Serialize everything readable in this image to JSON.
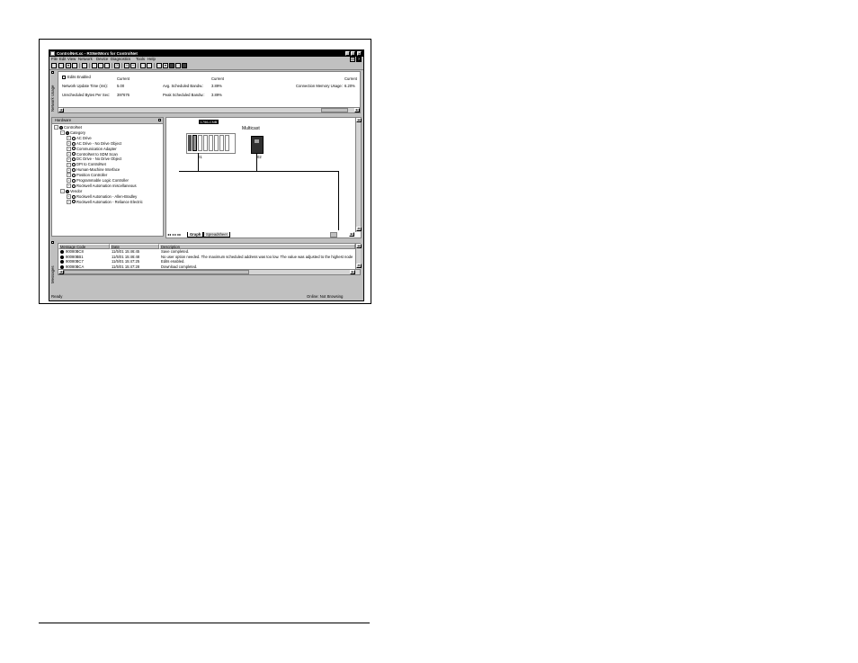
{
  "window": {
    "title": "ControlNet.xc - RSNetWorx for ControlNet"
  },
  "menu": [
    "File",
    "Edit",
    "View",
    "Network",
    "Device",
    "Diagnostics",
    "Tools",
    "Help"
  ],
  "network_usage": {
    "side_label": "Network Usage",
    "edits_enabled_label": "Edits Enabled",
    "col_current": "Current",
    "update_time_label": "Network Update Time (ms):",
    "update_time_value": "5.00",
    "unscheduled_label": "Unscheduled Bytes Per Sec:",
    "unscheduled_value": "397676",
    "avg_sched_label": "Avg. Scheduled Bandw.:",
    "avg_sched_value": "3.89%",
    "peak_sched_label": "Peak Scheduled Bandw.:",
    "peak_sched_value": "3.89%",
    "conn_mem_label": "Connection Memory Usage:",
    "conn_mem_value": "6.20%"
  },
  "hardware": {
    "title": "Hardware",
    "tree": [
      {
        "label": "ControlNet",
        "level": 0,
        "exp": "−"
      },
      {
        "label": "Category",
        "level": 1,
        "exp": "−"
      },
      {
        "label": "AC Drive",
        "level": 2,
        "exp": "+"
      },
      {
        "label": "AC Drive - No Drive Object",
        "level": 2,
        "exp": "+"
      },
      {
        "label": "Communication Adapter",
        "level": 2,
        "exp": "+"
      },
      {
        "label": "ControlNet to SDM Scan",
        "level": 2,
        "exp": "+"
      },
      {
        "label": "DC Drive - No Drive Object",
        "level": 2,
        "exp": "+"
      },
      {
        "label": "DPI to ControlNet",
        "level": 2,
        "exp": "+"
      },
      {
        "label": "Human-Machine Interface",
        "level": 2,
        "exp": "+"
      },
      {
        "label": "Position Controller",
        "level": 2,
        "exp": "+"
      },
      {
        "label": "Programmable Logic Controller",
        "level": 2,
        "exp": "+"
      },
      {
        "label": "Rockwell Automation miscellaneous",
        "level": 2,
        "exp": "+"
      },
      {
        "label": "Vendor",
        "level": 1,
        "exp": "−"
      },
      {
        "label": "Rockwell Automation - Allen-Bradley",
        "level": 2,
        "exp": "+"
      },
      {
        "label": "Rockwell Automation - Reliance Electric",
        "level": 2,
        "exp": "+"
      }
    ]
  },
  "graph": {
    "selected_label": "1756-CNB",
    "multicast_label": "Multicast",
    "node1": "01",
    "node2": "02",
    "tabs": [
      "Graph",
      "Spreadsheet"
    ]
  },
  "messages": {
    "side_label": "Messages",
    "headers": [
      "Message Code",
      "Date",
      "Description"
    ],
    "rows": [
      {
        "code": "90080BC8",
        "date": "11/5/01 15:46:45",
        "desc": "Save completed."
      },
      {
        "code": "90080BB1",
        "date": "11/5/01 15:46:48",
        "desc": "No user option needed. The maximum scheduled address was too low. The value was adjusted to the highest node used."
      },
      {
        "code": "90080BC7",
        "date": "11/5/01 15:47:25",
        "desc": "Edits enabled."
      },
      {
        "code": "90080BCA",
        "date": "11/5/01 15:47:28",
        "desc": "Download completed."
      }
    ]
  },
  "status": {
    "left": "Ready",
    "right": "Online: Not Browsing"
  }
}
